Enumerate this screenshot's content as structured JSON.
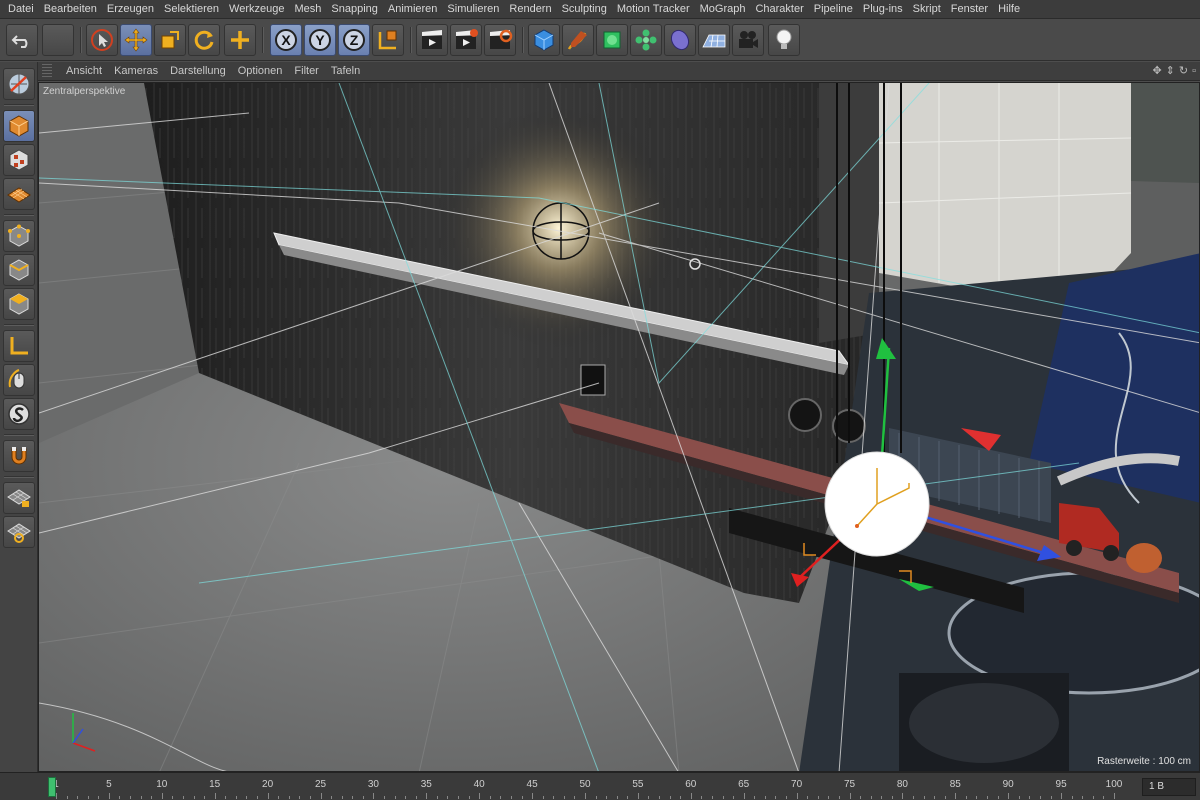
{
  "menubar": {
    "items": [
      "Datei",
      "Bearbeiten",
      "Erzeugen",
      "Selektieren",
      "Werkzeuge",
      "Mesh",
      "Snapping",
      "Animieren",
      "Simulieren",
      "Rendern",
      "Sculpting",
      "Motion Tracker",
      "MoGraph",
      "Charakter",
      "Pipeline",
      "Plug-ins",
      "Skript",
      "Fenster",
      "Hilfe"
    ]
  },
  "toolbar": {
    "axis_x": "X",
    "axis_y": "Y",
    "axis_z": "Z",
    "icons": [
      "undo-icon",
      "redo-icon",
      "live-selection-icon",
      "move-icon",
      "scale-icon",
      "rotate-icon",
      "add-icon",
      "axis-x",
      "axis-y",
      "axis-z",
      "coordinate-system-icon",
      "render-view-icon",
      "render-picture-queue-icon",
      "render-settings-icon",
      "cube-icon",
      "pen-icon",
      "subdivision-icon",
      "cloner-icon",
      "deformer-icon",
      "floor-icon",
      "camera-icon",
      "light-icon"
    ]
  },
  "leftbar": {
    "icons": [
      "make-editable-icon",
      "model-mode-icon",
      "texture-mode-icon",
      "workplane-icon",
      "points-mode-icon",
      "edges-mode-icon",
      "polygons-mode-icon",
      "axis-mode-icon",
      "tweak-mode-icon",
      "soft-selection-icon",
      "magnet-icon",
      "snapping-icon",
      "workplane-lock-icon",
      "locked-workplane-icon"
    ]
  },
  "viewport": {
    "menu": [
      "Ansicht",
      "Kameras",
      "Darstellung",
      "Optionen",
      "Filter",
      "Tafeln"
    ],
    "camera_label": "Zentralperspektive",
    "grid_spacing": "Rasterweite : 100 cm"
  },
  "timeline": {
    "ticks": [
      "1",
      "5",
      "10",
      "15",
      "20",
      "25",
      "30",
      "35",
      "40",
      "45",
      "50",
      "55",
      "60",
      "65",
      "70",
      "75",
      "80",
      "85",
      "90",
      "95",
      "100"
    ],
    "current_frame": "1 B"
  },
  "colors": {
    "accent": "#6a80b0",
    "axis_x": "#e02020",
    "axis_y": "#20c040",
    "axis_z": "#3050e0"
  }
}
